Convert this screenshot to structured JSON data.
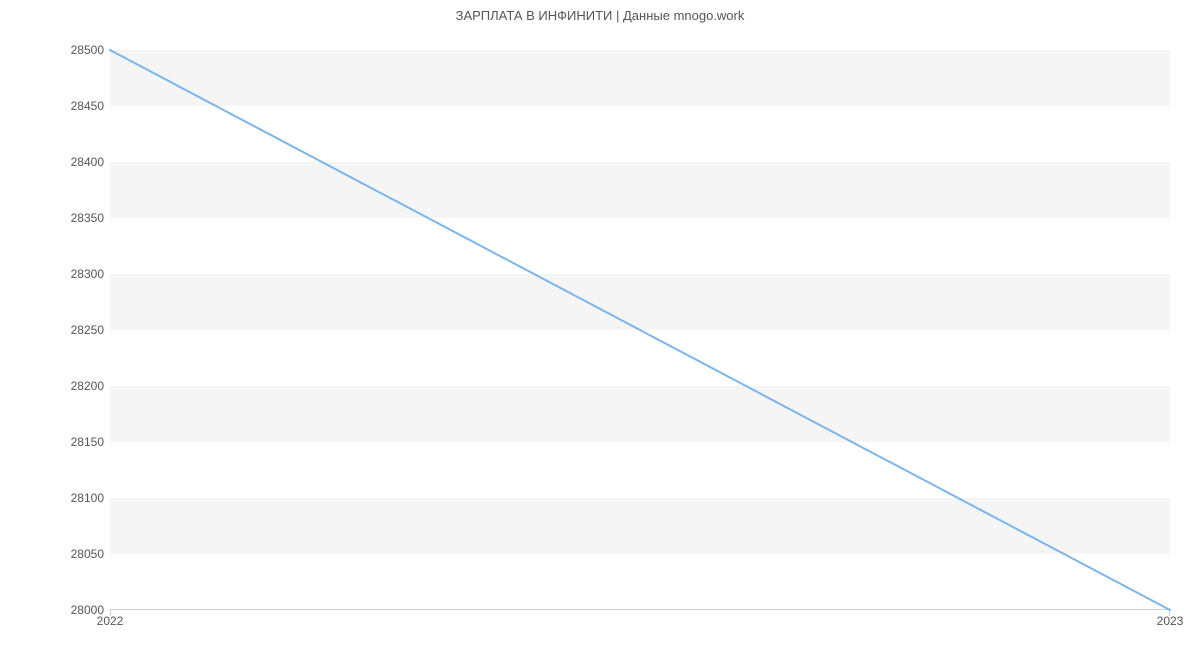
{
  "chart_data": {
    "type": "line",
    "title": "ЗАРПЛАТА В  ИНФИНИТИ | Данные mnogo.work",
    "xlabel": "",
    "ylabel": "",
    "x": [
      "2022",
      "2023"
    ],
    "values": [
      28500,
      28000
    ],
    "ylim": [
      28000,
      28500
    ],
    "y_ticks": [
      28000,
      28050,
      28100,
      28150,
      28200,
      28250,
      28300,
      28350,
      28400,
      28450,
      28500
    ],
    "x_ticks": [
      "2022",
      "2023"
    ],
    "line_color": "#7cb5ec",
    "band_color": "#f5f5f5",
    "grid": true
  }
}
